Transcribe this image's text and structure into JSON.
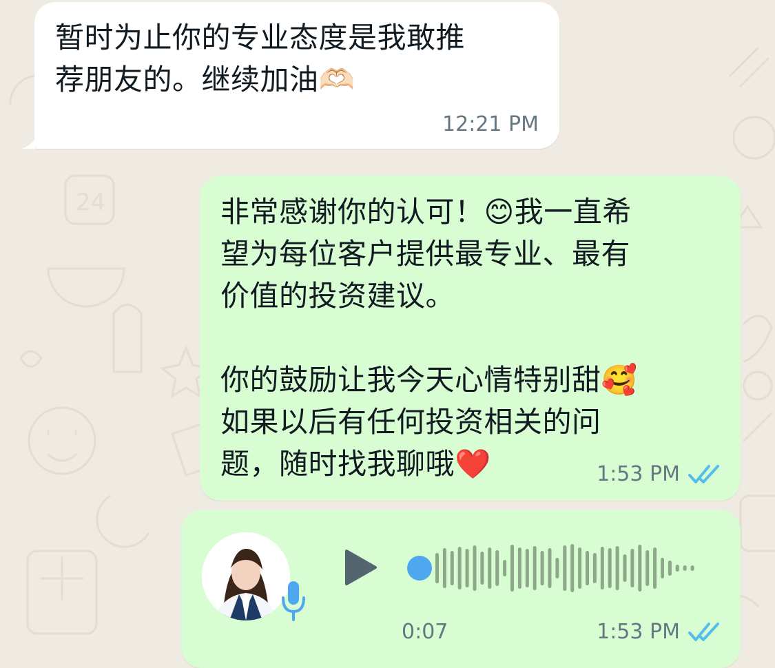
{
  "messages": [
    {
      "direction": "incoming",
      "text": "暂时为止你的专业态度是我敢推\n荐朋友的。继续加油🫶🏻",
      "time": "12:21 PM"
    },
    {
      "direction": "outgoing",
      "text": "非常感谢你的认可！😊我一直希\n望为每位客户提供最专业、最有\n价值的投资建议。\n\n你的鼓励让我今天心情特别甜🥰\n如果以后有任何投资相关的问\n题，随时找我聊哦❤️",
      "time": "1:53 PM",
      "status_icon": "double-check-icon"
    },
    {
      "direction": "outgoing",
      "type": "voice-note",
      "duration": "0:07",
      "time": "1:53 PM",
      "status_icon": "double-check-icon"
    }
  ],
  "colors": {
    "wallpaper": "#efeae2",
    "incoming_bubble": "#ffffff",
    "outgoing_bubble": "#d9fdd3",
    "timestamp": "#667781",
    "read_ticks": "#53bdeb",
    "voice_dot": "#4fa7f0",
    "waveform": "#8ea68a",
    "play_button": "#54656f"
  }
}
